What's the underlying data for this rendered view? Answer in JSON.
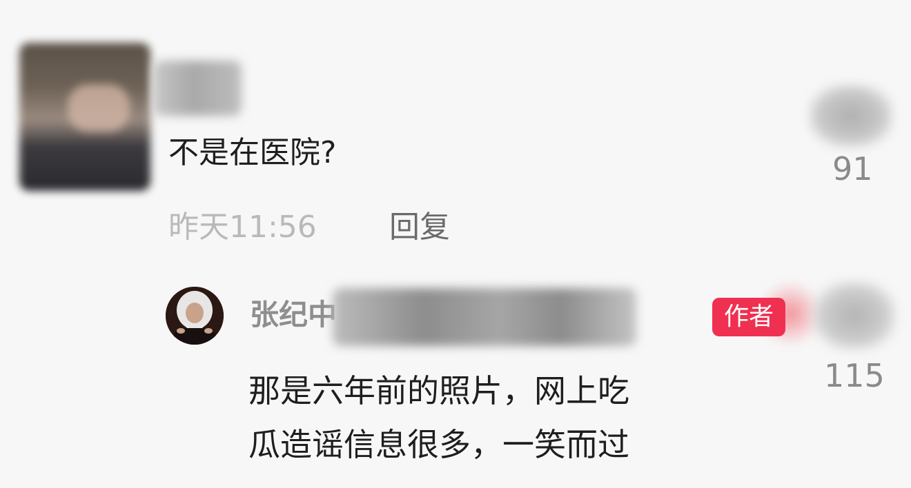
{
  "comment": {
    "text": "不是在医院?",
    "time": "昨天11:56",
    "reply_label": "回复",
    "like_count": "91"
  },
  "reply": {
    "author_name": "张纪中",
    "author_badge": "作者",
    "text_line_1": "那是六年前的照片，网上吃",
    "text_line_2": "瓜造谣信息很多，一笑而过",
    "like_count": "115"
  },
  "colors": {
    "badge": "#ef3050",
    "text_primary": "#1e1e1e",
    "text_muted": "#b9b9b9",
    "background": "#f7f7f7"
  },
  "icons": {
    "like": "like-icon"
  }
}
